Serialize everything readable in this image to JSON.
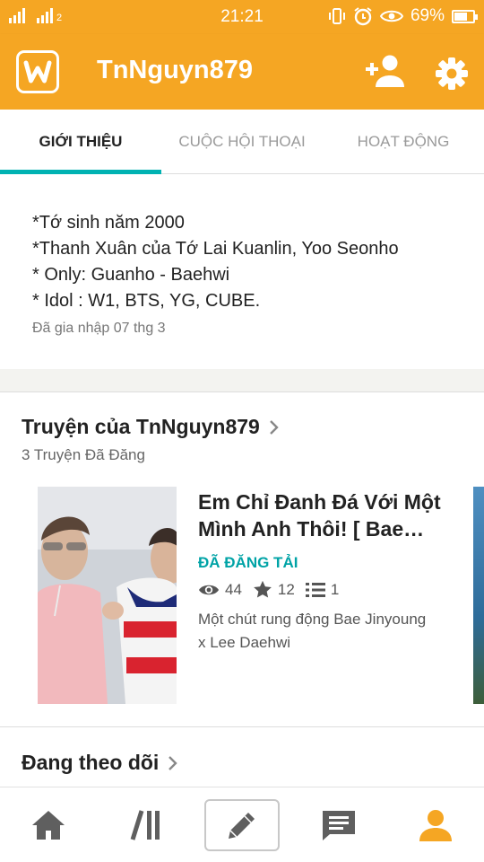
{
  "status_bar": {
    "time": "21:21",
    "battery": "69%",
    "battery_level": 0.69,
    "sim_tag": "2"
  },
  "app_bar": {
    "title": "TnNguyn879",
    "logo_icon": "wattpad-logo-icon",
    "actions": [
      "add-user-icon",
      "gear-icon"
    ]
  },
  "tabs": [
    {
      "label": "GIỚI THIỆU",
      "active": true
    },
    {
      "label": "CUỘC HỘI THOẠI",
      "active": false
    },
    {
      "label": "HOẠT ĐỘNG",
      "active": false
    }
  ],
  "about": {
    "lines": [
      "*Tớ sinh năm 2000",
      "*Thanh Xuân của Tớ Lai Kuanlin, Yoo Seonho",
      "* Only: Guanho - Baehwi",
      "* Idol : W1, BTS, YG, CUBE."
    ],
    "joined": "Đã gia nhập 07 thg 3"
  },
  "stories": {
    "title": "Truyện của TnNguyn879",
    "subtitle": "3 Truyện Đã Đăng",
    "items": [
      {
        "title_line1": "Em Chỉ Đanh Đá Với Một",
        "title_line2": "Mình Anh Thôi! [ Bae…",
        "status": "ĐÃ ĐĂNG TẢI",
        "reads": "44",
        "votes": "12",
        "parts": "1",
        "description_line1": "Một chút rung động Bae Jinyoung",
        "description_line2": "x Lee Daehwi"
      }
    ]
  },
  "following": {
    "title": "Đang theo dõi"
  },
  "bottom_nav": {
    "items": [
      "home-icon",
      "library-icon",
      "write-icon",
      "messages-icon",
      "profile-icon"
    ],
    "active": "profile-icon"
  },
  "colors": {
    "brand": "#f5a623",
    "tab_indicator": "#00b2b2",
    "status_teal": "#00a3a6",
    "nav_icon": "#5f5f5f"
  }
}
